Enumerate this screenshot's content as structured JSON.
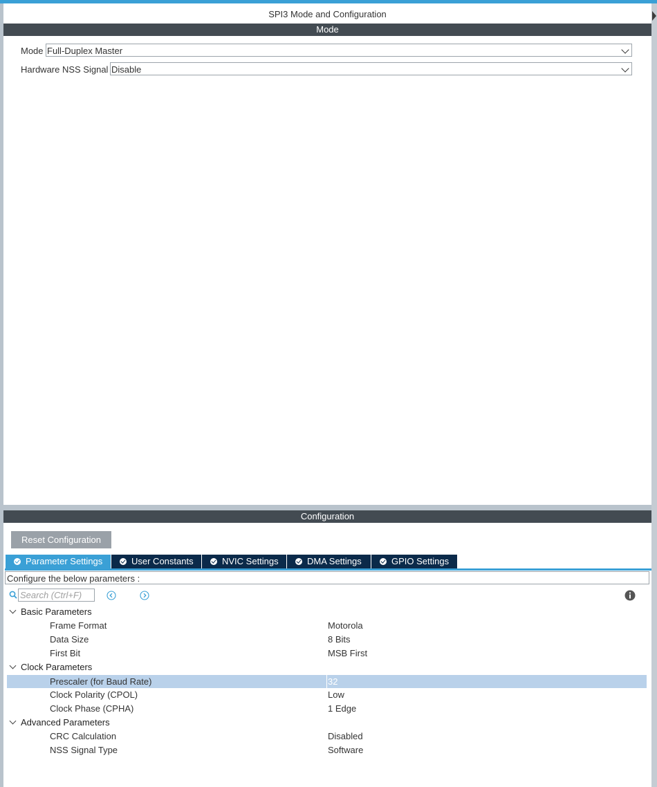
{
  "window": {
    "title": "SPI3 Mode and Configuration"
  },
  "mode_section": {
    "header": "Mode",
    "fields": [
      {
        "label": "Mode",
        "value": "Full-Duplex Master"
      },
      {
        "label": "Hardware NSS Signal",
        "value": "Disable"
      }
    ]
  },
  "config_section": {
    "header": "Configuration",
    "reset_label": "Reset Configuration",
    "tabs": [
      {
        "label": "Parameter Settings",
        "active": true
      },
      {
        "label": "User Constants",
        "active": false
      },
      {
        "label": "NVIC Settings",
        "active": false
      },
      {
        "label": "DMA Settings",
        "active": false
      },
      {
        "label": "GPIO Settings",
        "active": false
      }
    ],
    "info_text": "Configure the below parameters :",
    "search": {
      "placeholder": "Search (Ctrl+F)",
      "value": ""
    },
    "groups": [
      {
        "name": "Basic Parameters",
        "params": [
          {
            "name": "Frame Format",
            "value": "Motorola"
          },
          {
            "name": "Data Size",
            "value": "8 Bits"
          },
          {
            "name": "First Bit",
            "value": "MSB First"
          }
        ]
      },
      {
        "name": "Clock Parameters",
        "params": [
          {
            "name": "Prescaler (for Baud Rate)",
            "value": "32",
            "selected": true
          },
          {
            "name": "Clock Polarity (CPOL)",
            "value": "Low"
          },
          {
            "name": "Clock Phase (CPHA)",
            "value": "1 Edge"
          }
        ]
      },
      {
        "name": "Advanced Parameters",
        "params": [
          {
            "name": "CRC Calculation",
            "value": "Disabled"
          },
          {
            "name": "NSS Signal Type",
            "value": "Software"
          }
        ]
      }
    ]
  },
  "colors": {
    "accent": "#3aa0d6",
    "tab_dark": "#0b2a4a",
    "section_bar": "#434b52",
    "selected_row": "#b9d1ea",
    "button_gray": "#9aa1a8"
  }
}
